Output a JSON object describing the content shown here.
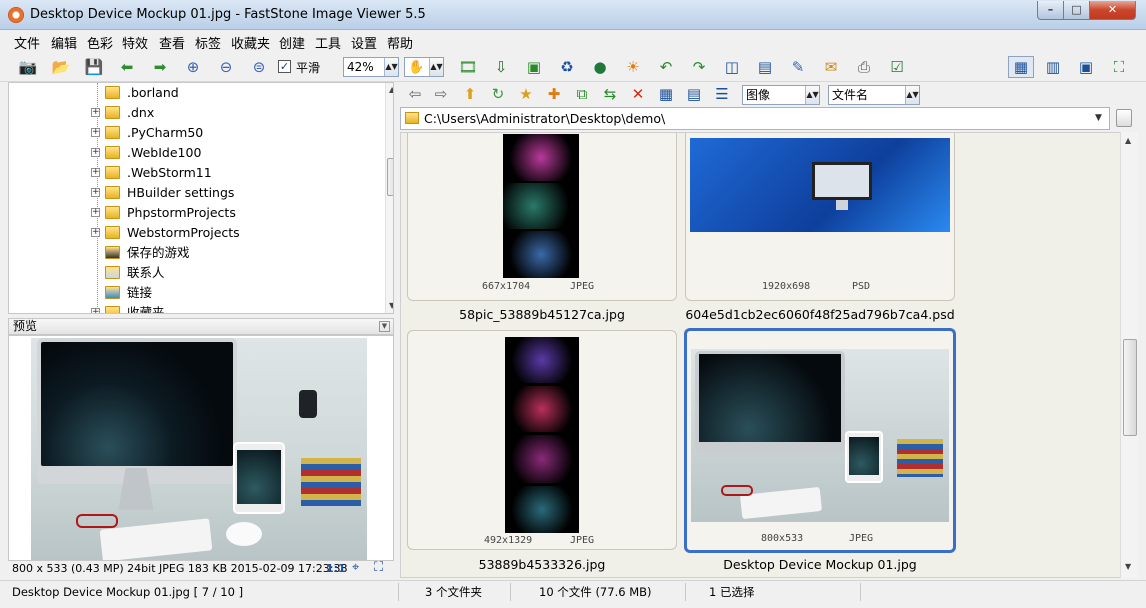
{
  "window": {
    "title": "Desktop Device Mockup 01.jpg  -  FastStone Image Viewer 5.5"
  },
  "menu": [
    "文件",
    "编辑",
    "色彩",
    "特效",
    "查看",
    "标签",
    "收藏夹",
    "创建",
    "工具",
    "设置",
    "帮助"
  ],
  "toolbar": {
    "smooth_label": "平滑",
    "zoom_value": "42%"
  },
  "nav": {
    "sort_type": "图像",
    "sort_by": "文件名"
  },
  "path": "C:\\Users\\Administrator\\Desktop\\demo\\",
  "tree": {
    "items": [
      ".borland",
      ".dnx",
      ".PyCharm50",
      ".WebIde100",
      ".WebStorm11",
      "HBuilder settings",
      "PhpstormProjects",
      "WebstormProjects",
      "保存的游戏",
      "联系人",
      "链接",
      "收藏夹"
    ]
  },
  "preview": {
    "header": "预览",
    "info": "800 x 533 (0.43 MP)  24bit  JPEG   183 KB   2015-02-09 17:23:38",
    "ratio": "1:1"
  },
  "thumbnails": [
    {
      "name": "58pic_53889b45127ca.jpg",
      "dims": "667x1704",
      "format": "JPEG",
      "selected": false
    },
    {
      "name": "604e5d1cb2ec6060f48f25ad796b7ca4.psd",
      "dims": "1920x698",
      "format": "PSD",
      "selected": false
    },
    {
      "name": "53889b4533326.jpg",
      "dims": "492x1329",
      "format": "JPEG",
      "selected": false
    },
    {
      "name": "Desktop Device Mockup 01.jpg",
      "dims": "800x533",
      "format": "JPEG",
      "selected": true
    }
  ],
  "status": {
    "file": "Desktop Device Mockup 01.jpg [ 7 / 10 ]",
    "folders": "3 个文件夹",
    "files": "10 个文件 (77.6 MB)",
    "selected": "1 已选择"
  },
  "colors": {
    "accent": "#3b6fc7",
    "title_bg": "#c9daef"
  }
}
